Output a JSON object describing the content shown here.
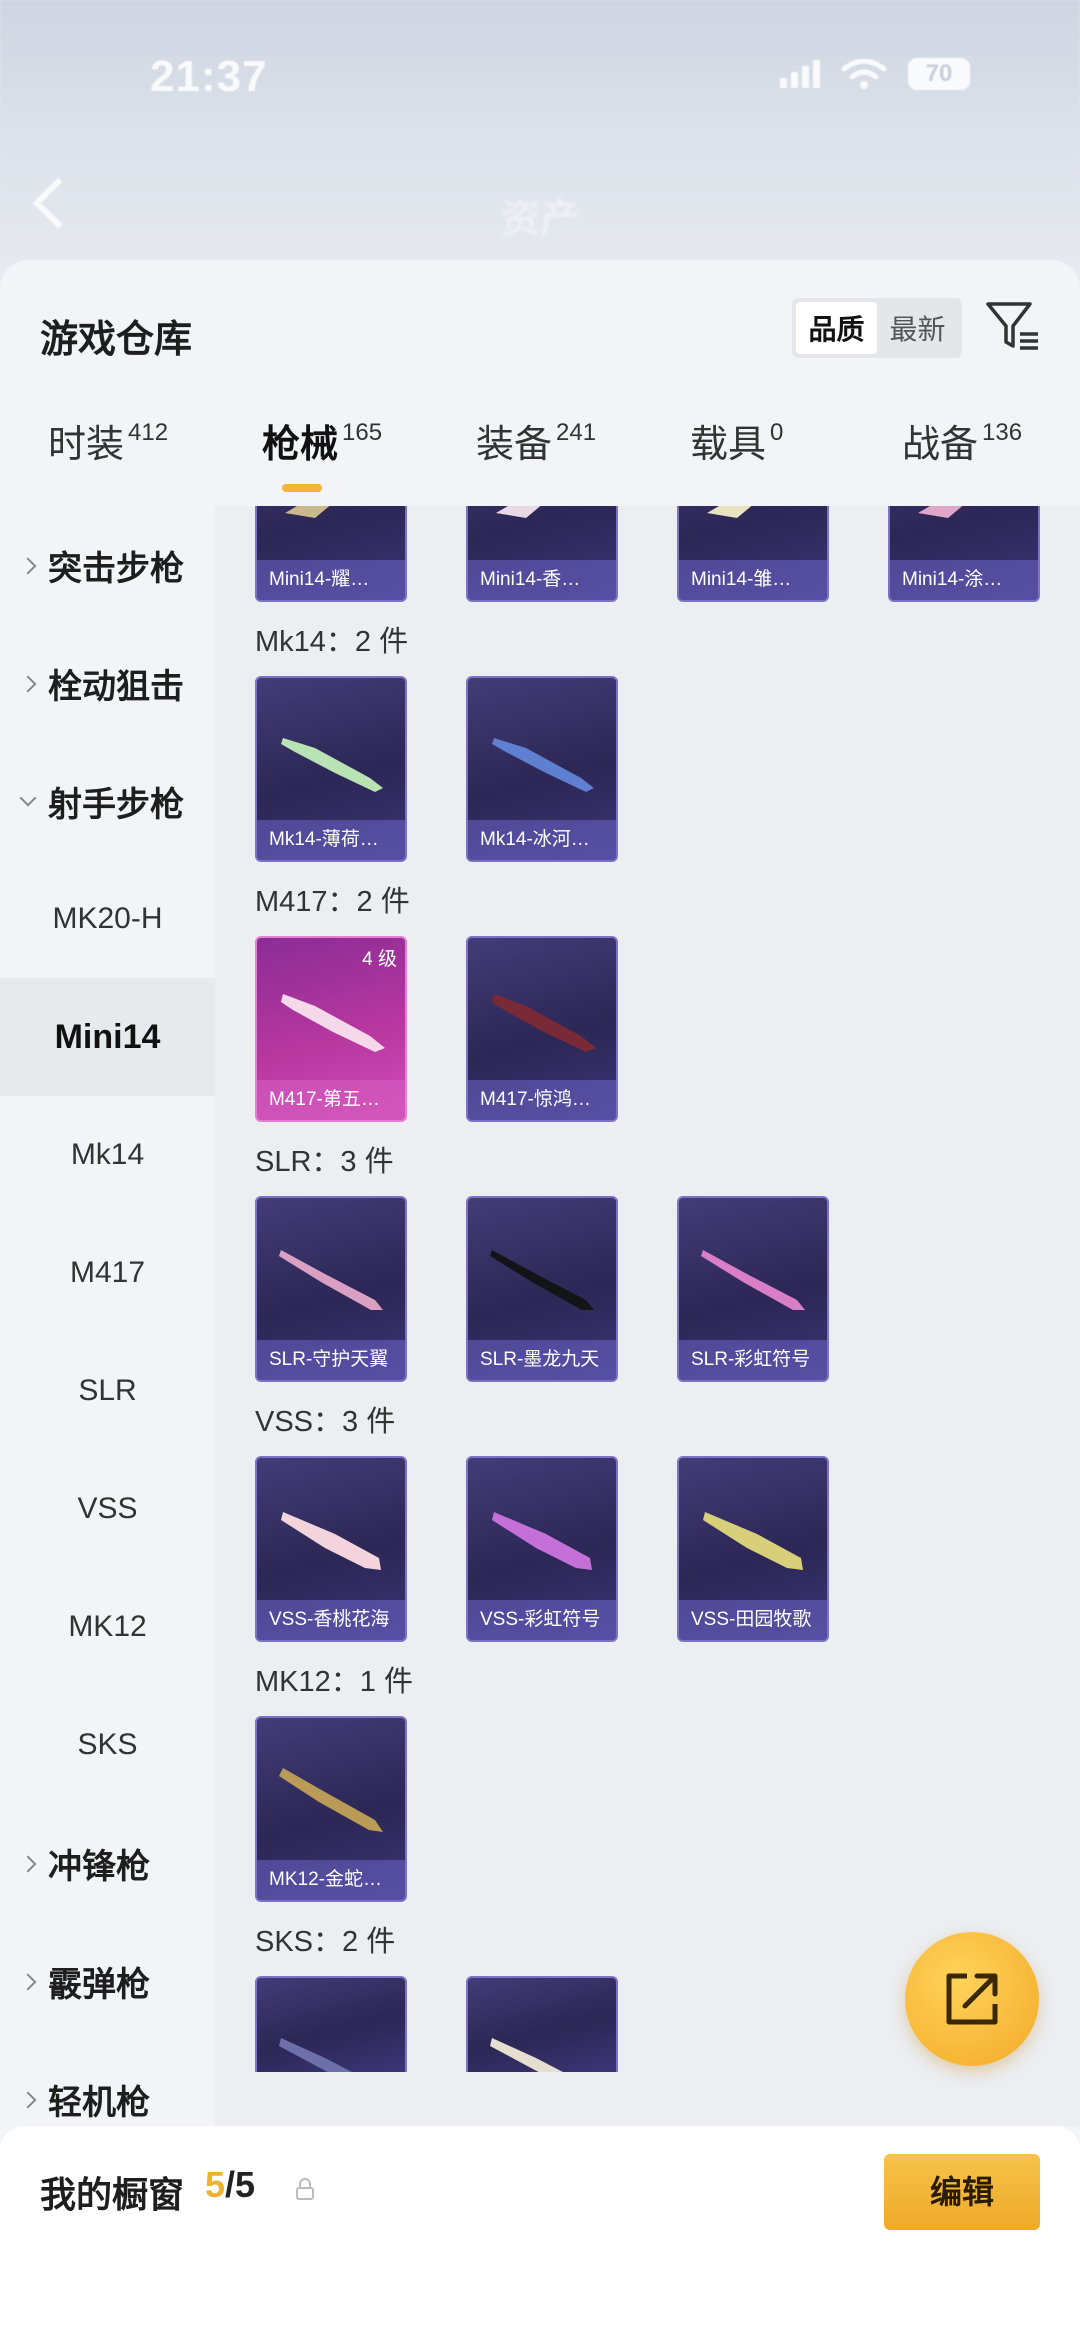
{
  "status_bar": {
    "time": "21:37",
    "battery": "70"
  },
  "header": {
    "title": "资产"
  },
  "sheet": {
    "title": "游戏仓库",
    "sort_options": [
      "品质",
      "最新"
    ],
    "tabs": [
      {
        "label": "时装",
        "count": "412"
      },
      {
        "label": "枪械",
        "count": "165"
      },
      {
        "label": "装备",
        "count": "241"
      },
      {
        "label": "载具",
        "count": "0"
      },
      {
        "label": "战备",
        "count": "136"
      }
    ]
  },
  "categories": [
    {
      "label": "突击步枪",
      "type": "group"
    },
    {
      "label": "栓动狙击",
      "type": "group"
    },
    {
      "label": "射手步枪",
      "type": "group-open"
    },
    {
      "label": "MK20-H",
      "type": "sub"
    },
    {
      "label": "Mini14",
      "type": "sub-selected"
    },
    {
      "label": "Mk14",
      "type": "sub"
    },
    {
      "label": "M417",
      "type": "sub"
    },
    {
      "label": "SLR",
      "type": "sub"
    },
    {
      "label": "VSS",
      "type": "sub"
    },
    {
      "label": "MK12",
      "type": "sub"
    },
    {
      "label": "SKS",
      "type": "sub"
    },
    {
      "label": "冲锋枪",
      "type": "group"
    },
    {
      "label": "霰弹枪",
      "type": "group"
    },
    {
      "label": "轻机枪",
      "type": "group"
    }
  ],
  "sections": {
    "mini14_items": [
      "Mini14-耀…",
      "Mini14-香…",
      "Mini14-雏…",
      "Mini14-涂…"
    ],
    "mk14": {
      "label": "Mk14：2 件",
      "items": [
        "Mk14-薄荷…",
        "Mk14-冰河…"
      ]
    },
    "m417": {
      "label": "M417：2 件",
      "items": [
        "M417-第五…",
        "M417-惊鸿…"
      ],
      "grade": "4 级"
    },
    "slr": {
      "label": "SLR：3 件",
      "items": [
        "SLR-守护天翼",
        "SLR-墨龙九天",
        "SLR-彩虹符号"
      ]
    },
    "vss": {
      "label": "VSS：3 件",
      "items": [
        "VSS-香桃花海",
        "VSS-彩虹符号",
        "VSS-田园牧歌"
      ]
    },
    "mk12": {
      "label": "MK12：1 件",
      "items": [
        "MK12-金蛇…"
      ]
    },
    "sks": {
      "label": "SKS：2 件"
    }
  },
  "bottom": {
    "showcase_label": "我的橱窗",
    "showcase_current": "5",
    "showcase_total": "/5",
    "edit_label": "编辑"
  },
  "colors": {
    "accent": "#f0b22e",
    "card_border": "#7b73c6",
    "card_bg": "#2c2755"
  }
}
